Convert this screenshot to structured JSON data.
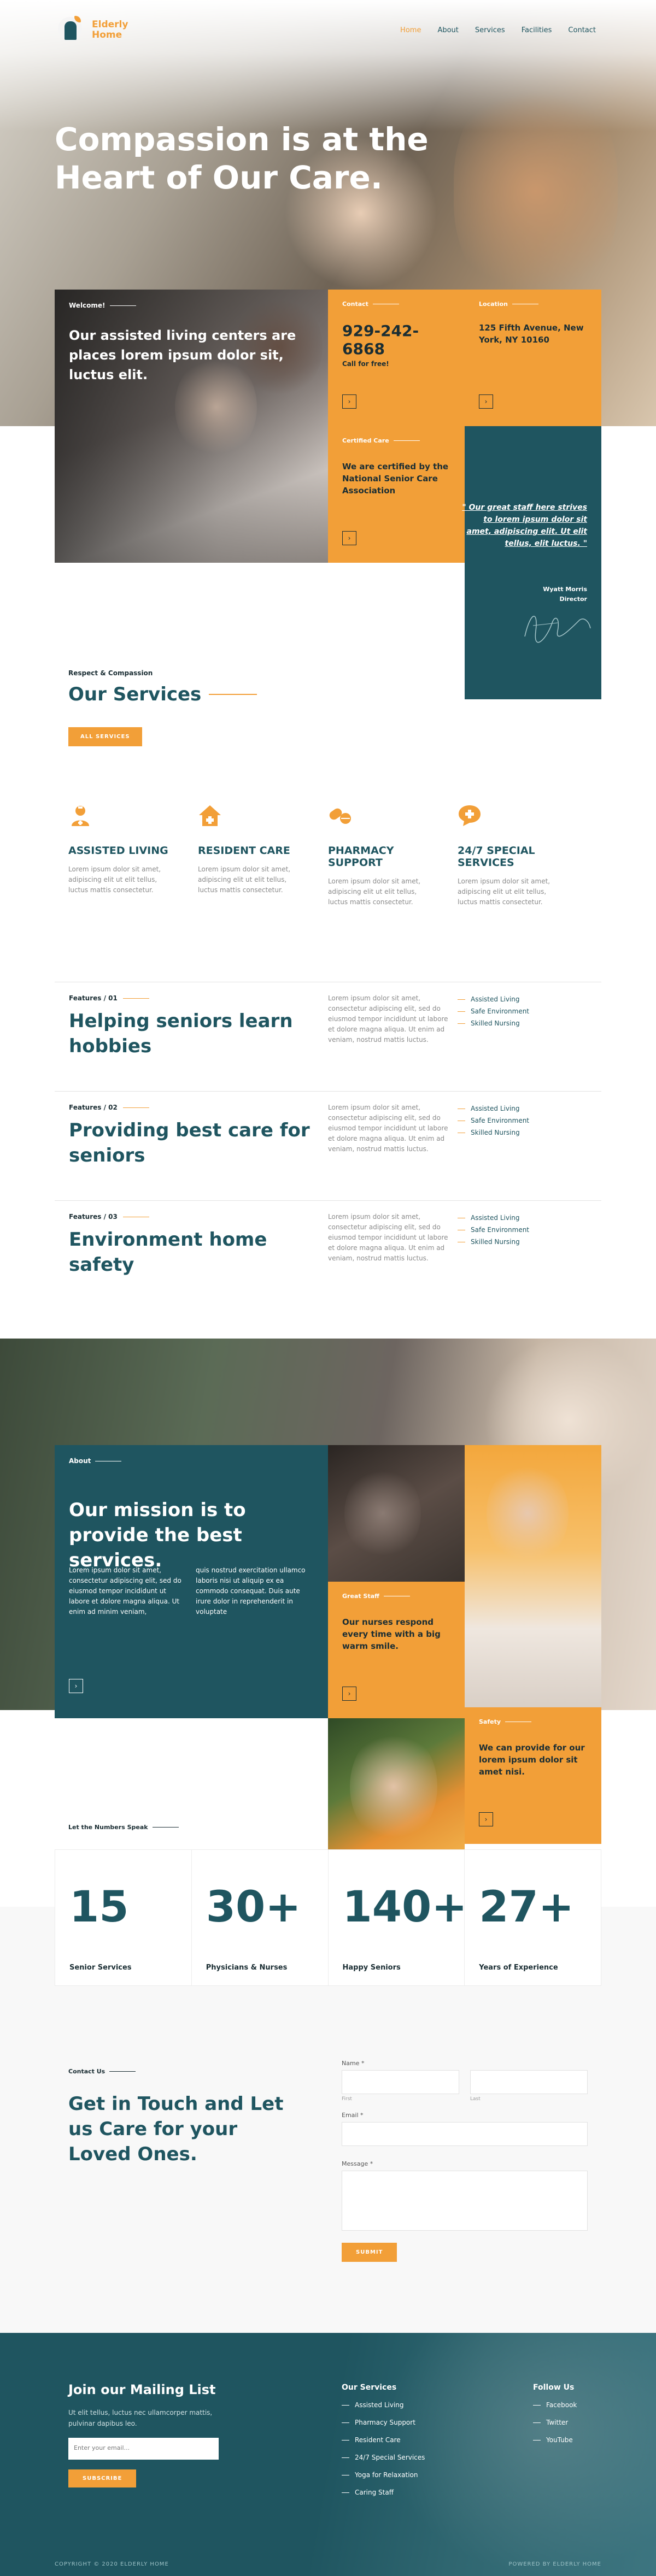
{
  "brand": {
    "line1": "Elderly",
    "line2": "Home"
  },
  "nav": [
    {
      "label": "Home",
      "active": true
    },
    {
      "label": "About"
    },
    {
      "label": "Services"
    },
    {
      "label": "Facilities"
    },
    {
      "label": "Contact"
    }
  ],
  "hero": {
    "title": "Compassion is at the Heart of Our Care."
  },
  "welcome": {
    "label": "Welcome!",
    "text": "Our assisted living centers are places lorem ipsum dolor sit, luctus elit."
  },
  "contact_cell": {
    "label": "Contact",
    "phone": "929-242-6868",
    "note": "Call for free!"
  },
  "location_cell": {
    "label": "Location",
    "address": "125 Fifth Avenue, New York, NY 10160"
  },
  "certified_cell": {
    "label": "Certified Care",
    "text": "We are certified by the National Senior Care Association"
  },
  "quote": {
    "text": "\" Our great staff here strives to lorem ipsum dolor sit amet, adipiscing elit. Ut elit tellus, elit luctus. \"",
    "name": "Wyatt Morris",
    "role": "Director"
  },
  "services": {
    "kicker": "Respect & Compassion",
    "title": "Our Services",
    "button": "ALL SERVICES",
    "items": [
      {
        "icon": "nurse-icon",
        "title": "ASSISTED LIVING",
        "desc": "Lorem ipsum dolor sit amet, adipiscing elit ut elit tellus, luctus mattis consectetur."
      },
      {
        "icon": "home-icon",
        "title": "RESIDENT CARE",
        "desc": "Lorem ipsum dolor sit amet, adipiscing elit ut elit tellus, luctus mattis consectetur."
      },
      {
        "icon": "pills-icon",
        "title": "PHARMACY SUPPORT",
        "desc": "Lorem ipsum dolor sit amet, adipiscing elit ut elit tellus, luctus mattis consectetur."
      },
      {
        "icon": "chat-plus-icon",
        "title": "24/7 SPECIAL SERVICES",
        "desc": "Lorem ipsum dolor sit amet, adipiscing elit ut elit tellus, luctus mattis consectetur."
      }
    ]
  },
  "features": [
    {
      "label": "Features / 01",
      "title": "Helping seniors learn hobbies",
      "text": "Lorem ipsum dolor sit amet, consectetur adipiscing elit, sed do eiusmod tempor incididunt ut labore et dolore magna aliqua. Ut enim ad veniam, nostrud mattis luctus.",
      "list": [
        "Assisted Living",
        "Safe Environment",
        "Skilled Nursing"
      ]
    },
    {
      "label": "Features / 02",
      "title": "Providing best care for seniors",
      "text": "Lorem ipsum dolor sit amet, consectetur adipiscing elit, sed do eiusmod tempor incididunt ut labore et dolore magna aliqua. Ut enim ad veniam, nostrud mattis luctus.",
      "list": [
        "Assisted Living",
        "Safe Environment",
        "Skilled Nursing"
      ]
    },
    {
      "label": "Features / 03",
      "title": "Environment home safety",
      "text": "Lorem ipsum dolor sit amet, consectetur adipiscing elit, sed do eiusmod tempor incididunt ut labore et dolore magna aliqua. Ut enim ad veniam, nostrud mattis luctus.",
      "list": [
        "Assisted Living",
        "Safe Environment",
        "Skilled Nursing"
      ]
    }
  ],
  "about": {
    "label": "About",
    "title": "Our mission is to provide the best services.",
    "p1": "Lorem ipsum dolor sit amet, consectetur adipiscing elit, sed do eiusmod tempor incididunt ut labore et dolore magna aliqua. Ut enim ad minim veniam,",
    "p2": "quis nostrud exercitation ullamco laboris nisi ut aliquip ex ea commodo consequat. Duis aute irure dolor in reprehenderit in voluptate"
  },
  "staff_cell": {
    "label": "Great Staff",
    "text": "Our nurses respond every time with a big warm smile."
  },
  "safety_cell": {
    "label": "Safety",
    "text": "We can provide for our lorem ipsum dolor sit amet nisi."
  },
  "numbers": {
    "kicker": "Let the Numbers Speak",
    "items": [
      {
        "value": "15",
        "label": "Senior Services"
      },
      {
        "value": "30+",
        "label": "Physicians & Nurses"
      },
      {
        "value": "140+",
        "label": "Happy Seniors"
      },
      {
        "value": "27+",
        "label": "Years of Experience"
      }
    ]
  },
  "contact": {
    "kicker": "Contact Us",
    "title": "Get in Touch and Let us Care for your Loved Ones.",
    "name_label": "Name *",
    "first_label": "First",
    "last_label": "Last",
    "email_label": "Email *",
    "message_label": "Message *",
    "submit": "SUBMIT"
  },
  "footer": {
    "mailing_title": "Join our Mailing List",
    "mailing_text": "Ut elit tellus, luctus nec ullamcorper mattis, pulvinar dapibus leo.",
    "email_placeholder": "Enter your email...",
    "subscribe": "SUBSCRIBE",
    "services_title": "Our Services",
    "services": [
      "Assisted Living",
      "Pharmacy Support",
      "Resident Care",
      "24/7 Special Services",
      "Yoga for Relaxation",
      "Caring Staff"
    ],
    "follow_title": "Follow Us",
    "follow": [
      "Facebook",
      "Twitter",
      "YouTube"
    ],
    "copyright": "COPYRIGHT © 2020 ELDERLY HOME",
    "powered": "POWERED BY ELDERLY HOME"
  },
  "colors": {
    "accent": "#f29f38",
    "primary": "#1f5560"
  }
}
